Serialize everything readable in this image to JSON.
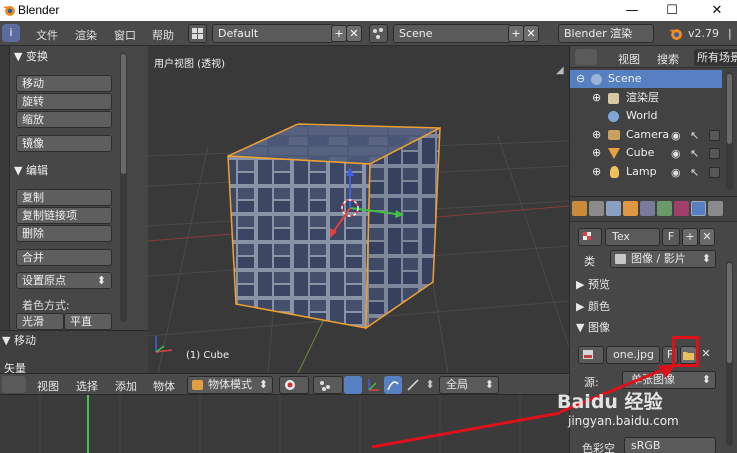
{
  "window": {
    "title": "Blender",
    "minimize": "—",
    "maximize": "☐",
    "close": "✕"
  },
  "info_header": {
    "menus": [
      "文件",
      "渲染",
      "窗口",
      "帮助"
    ],
    "screen_layout": "Default",
    "scene": "Scene",
    "render_engine": "Blender 渲染",
    "version": "v2.79",
    "version_suffix": "|",
    "add": "+",
    "remove": "✕"
  },
  "tool_shelf": {
    "transform": {
      "title": "▼ 变换",
      "buttons": [
        "移动",
        "旋转",
        "缩放",
        "镜像"
      ]
    },
    "edit": {
      "title": "▼ 编辑",
      "buttons": [
        "复制",
        "复制链接项",
        "删除",
        "合并"
      ],
      "set_origin": "设置原点",
      "shading_label": "着色方式:",
      "shading_smooth": "光滑",
      "shading_flat": "平直"
    }
  },
  "operator_panel": {
    "title": "▼ 移动",
    "field": "矢量"
  },
  "viewport": {
    "view_name": "用户视图 (透视)",
    "object_label": "(1) Cube"
  },
  "outliner": {
    "menu_view": "视图",
    "menu_search": "搜索",
    "filter": "所有场景",
    "rows": [
      {
        "label": "Scene",
        "level": 0
      },
      {
        "label": "渲染层",
        "level": 1
      },
      {
        "label": "World",
        "level": 1
      },
      {
        "label": "Camera",
        "level": 1
      },
      {
        "label": "Cube",
        "level": 1
      },
      {
        "label": "Lamp",
        "level": 1
      }
    ]
  },
  "properties": {
    "texture_name": "Tex",
    "fake_user": "F",
    "add": "+",
    "remove": "✕",
    "type_label": "类",
    "type_value": "图像 / 影片",
    "panels": [
      "▶ 预览",
      "▶ 颜色",
      "▼ 图像"
    ],
    "image_name": "one.jpg",
    "image_fake": "F",
    "source_label": "源:",
    "source_value": "单张图像",
    "color_space_label": "色彩空",
    "color_space_value": "sRGB"
  },
  "bottom_header": {
    "menus": [
      "视图",
      "选择",
      "添加",
      "物体"
    ],
    "mode": "物体模式",
    "pivot_global": "全局"
  },
  "watermark": {
    "brand": "Baidu 经验",
    "url": "jingyan.baidu.com"
  },
  "colors": {
    "selection": "#5680c2",
    "accent_orange": "#f0a030",
    "highlight_red": "#e0101a"
  }
}
